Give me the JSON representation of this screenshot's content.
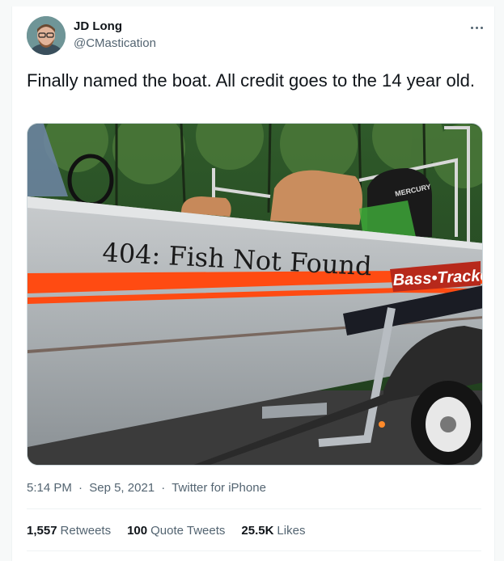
{
  "author": {
    "name": "JD Long",
    "handle": "@CMastication"
  },
  "tweet": {
    "text": "Finally named the boat. All credit goes to the 14 year old."
  },
  "image": {
    "boat_text": "404: Fish Not Found",
    "brand_text": "Bass•Tracker",
    "motor_text": "MERCURY"
  },
  "meta": {
    "time": "5:14 PM",
    "date": "Sep 5, 2021",
    "client": "Twitter for iPhone",
    "separator": "·"
  },
  "stats": {
    "retweets": {
      "count": "1,557",
      "label": "Retweets"
    },
    "quotes": {
      "count": "100",
      "label": "Quote Tweets"
    },
    "likes": {
      "count": "25.5K",
      "label": "Likes"
    }
  },
  "colors": {
    "link": "#1d9bf0",
    "muted": "#536471",
    "stripe": "#ff4b12"
  }
}
